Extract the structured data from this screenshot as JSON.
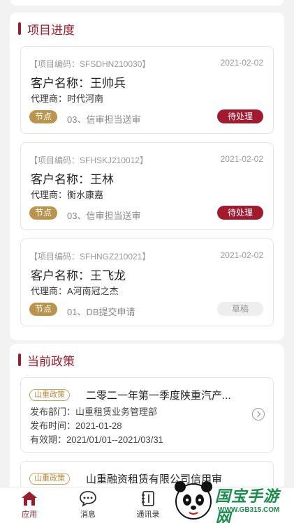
{
  "progress": {
    "title": "项目进度",
    "items": [
      {
        "code": "【项目编码：SFSDHN210030】",
        "date": "2021-02-02",
        "customer": "客户名称：王帅兵",
        "agent": "代理商：时代河南",
        "node_tag": "节点",
        "node": "03、信审担当送审",
        "status": "待处理",
        "status_type": "pending"
      },
      {
        "code": "【项目编码：SFHSKJ210012】",
        "date": "2021-02-02",
        "customer": "客户名称：王林",
        "agent": "代理商：衡水康嘉",
        "node_tag": "节点",
        "node": "03、信审担当送审",
        "status": "待处理",
        "status_type": "pending"
      },
      {
        "code": "【项目编码：SFHNGZ210021】",
        "date": "2021-02-02",
        "customer": "客户名称：王飞龙",
        "agent": "代理商：A河南冠之杰",
        "node_tag": "节点",
        "node": "01、DB提交申请",
        "status": "草稿",
        "status_type": "draft"
      }
    ]
  },
  "policy": {
    "title": "当前政策",
    "items": [
      {
        "tag": "山重政策",
        "title": "二零二一年第一季度陕重汽产...",
        "dept": "发布部门：山重租赁业务管理部",
        "time": "发布时间：2021-01-28",
        "valid": "有效期：2021/01/01--2021/03/31"
      },
      {
        "tag": "山重政策",
        "title": "山重融资租赁有限公司信用审"
      }
    ]
  },
  "tabbar": {
    "tabs": [
      {
        "label": "应用",
        "icon": "home-icon",
        "active": true
      },
      {
        "label": "消息",
        "icon": "message-icon",
        "active": false
      },
      {
        "label": "通讯录",
        "icon": "contacts-icon",
        "active": false
      }
    ]
  },
  "watermark": {
    "text": "国宝手游网",
    "url": "WWW.GB315.COM"
  },
  "colors": {
    "accent": "#9b1c2e",
    "gold": "#b9944c",
    "background": "#f2f2f2"
  }
}
